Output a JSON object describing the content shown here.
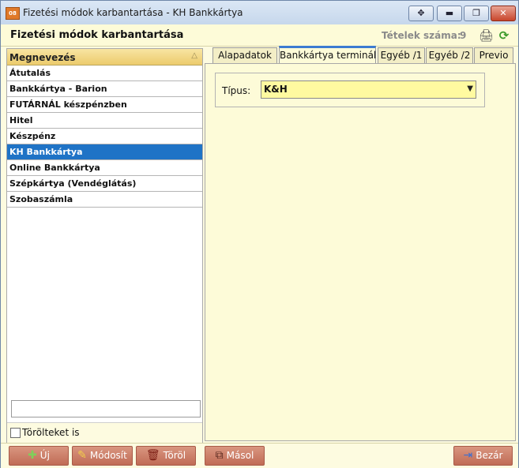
{
  "window": {
    "app_icon_text": "08",
    "title": "Fizetési módok karbantartása - KH Bankkártya",
    "buttons": {
      "move": "✥",
      "minimize": "▬",
      "maximize": "❐",
      "close": "✕"
    }
  },
  "header": {
    "title": "Fizetési módok karbantartása",
    "count_label": "Tételek száma:",
    "count_value": "9",
    "print_icon": "🖨",
    "refresh_icon": "⟳"
  },
  "list": {
    "column_header": "Megnevezés",
    "sort_icon": "△",
    "items": [
      "Átutalás",
      "Bankkártya - Barion",
      "FUTÁRNÁL készpénzben",
      "Hitel",
      "Készpénz",
      "KH Bankkártya",
      "Online Bankkártya",
      "Szépkártya (Vendéglátás)",
      "Szobaszámla"
    ],
    "selected_index": 5,
    "filter_value": "",
    "show_deleted_label": "Törölteket is",
    "show_deleted_checked": false
  },
  "tabs": {
    "items": [
      "Alapadatok",
      "Bankkártya terminál",
      "Egyéb /1",
      "Egyéb /2",
      "Previo"
    ],
    "active_index": 1
  },
  "terminal": {
    "type_label": "Típus:",
    "type_value": "K&H",
    "dropdown_icon": "▼"
  },
  "footer": {
    "new_label": "Új",
    "new_icon": "✚",
    "modify_label": "Módosít",
    "modify_icon": "✎",
    "delete_label": "Töröl",
    "delete_icon": "🗑",
    "copy_label": "Másol",
    "copy_icon": "⧉",
    "close_label": "Bezár",
    "close_icon": "⇥"
  },
  "colors": {
    "selection": "#1f73c6",
    "list_header": "#eccb6c",
    "button": "#c06b55",
    "panel": "#fdfbd8",
    "combo": "#fffaa0"
  }
}
